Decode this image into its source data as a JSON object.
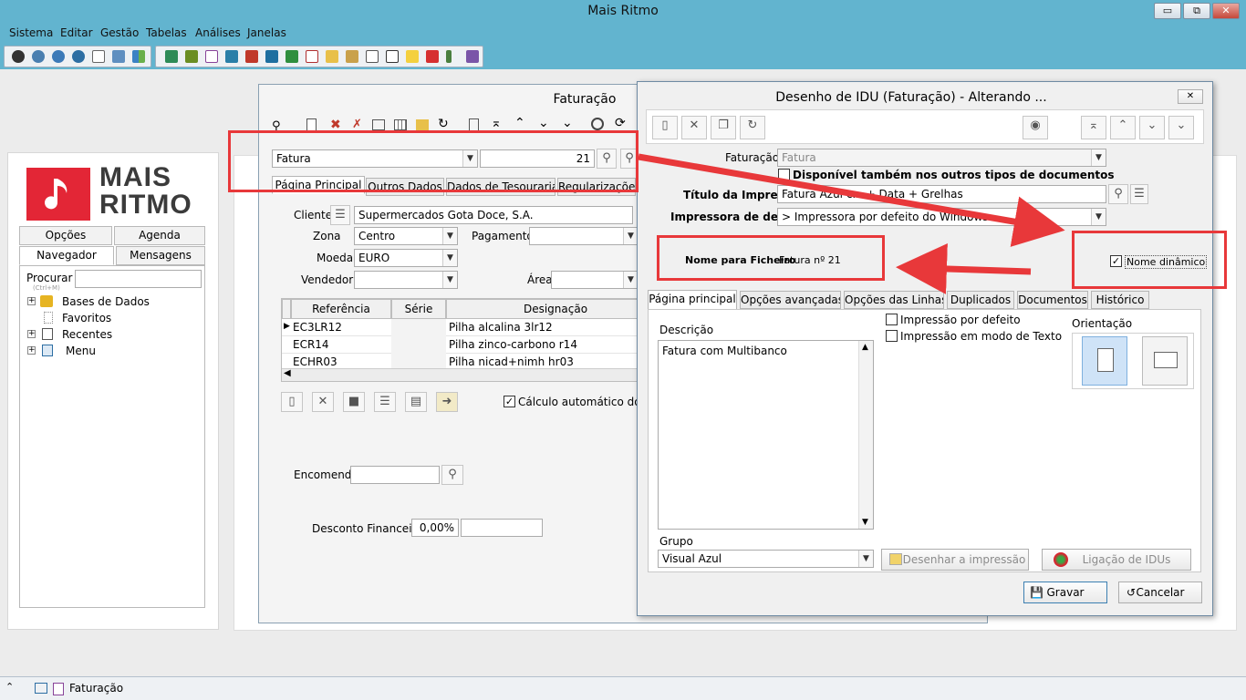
{
  "app": {
    "title": "Mais Ritmo",
    "menu": [
      "Sistema",
      "Editar",
      "Gestão",
      "Tabelas",
      "Análises",
      "Janelas"
    ],
    "window_buttons": {
      "minimize": "▭",
      "restore": "⧉",
      "close": "✕"
    }
  },
  "left_panel": {
    "logo": {
      "line1": "MAIS",
      "line2": "RITMO"
    },
    "tabs": [
      "Opções",
      "Agenda",
      "Navegador",
      "Mensagens"
    ],
    "search_label": "Procurar :",
    "search_hint": "(Ctrl+M)",
    "tree": [
      "Bases de Dados",
      "Favoritos",
      "Recentes",
      "Menu"
    ]
  },
  "faturacao": {
    "title": "Faturação",
    "doc_type": "Fatura",
    "doc_number": "21",
    "tabs": [
      "Página Principal",
      "Outros Dados",
      "Dados de Tesouraria",
      "Regularizações"
    ],
    "labels": {
      "cliente": "Cliente",
      "zona": "Zona",
      "pagamento": "Pagamento",
      "moeda": "Moeda",
      "vendedor": "Vendedor",
      "area": "Área",
      "encomenda": "Encomenda",
      "desconto": "Desconto Financeiro",
      "calculo": "Cálculo automático dos to"
    },
    "values": {
      "cliente": "Supermercados Gota Doce, S.A.",
      "zona": "Centro",
      "moeda": "EURO",
      "desconto": "0,00%"
    },
    "grid": {
      "headers": [
        "Referência",
        "Série",
        "Designação"
      ],
      "rows": [
        {
          "ref": "EC3LR12",
          "serie": "",
          "designacao": "Pilha alcalina 3lr12"
        },
        {
          "ref": "ECR14",
          "serie": "",
          "designacao": "Pilha zinco-carbono r14"
        },
        {
          "ref": "ECHR03",
          "serie": "",
          "designacao": "Pilha nicad+nimh hr03"
        }
      ]
    }
  },
  "idu": {
    "title": "Desenho de IDU (Faturação) - Alterando ...",
    "labels": {
      "faturacao": "Faturação",
      "disponivel": "Disponível também nos outros tipos de documentos",
      "titulo": "Título da Impressão",
      "impressora": "Impressora de destino",
      "nome_ficheiro": "Nome para Ficheiro",
      "nome_dinamico": "Nome dinâmico",
      "descricao": "Descrição",
      "impressao_defeito": "Impressão por defeito",
      "impressao_texto": "Impressão em modo de Texto",
      "orientacao": "Orientação",
      "grupo": "Grupo"
    },
    "values": {
      "faturacao": "Fatura",
      "titulo": "Fatura Azul c... + Data + Grelhas",
      "impressora": "> Impressora por defeito do Windows",
      "nome_ficheiro": "Fatura nº 21",
      "descricao": "Fatura com Multibanco",
      "grupo": "Visual Azul"
    },
    "tabs": [
      "Página principal",
      "Opções avançadas",
      "Opções das Linhas",
      "Duplicados",
      "Documentos",
      "Histórico"
    ],
    "buttons": {
      "desenhar": "Desenhar a impressão",
      "ligacao": "Ligação de IDUs",
      "gravar": "Gravar",
      "cancelar": "Cancelar"
    },
    "checked": {
      "disponivel": false,
      "nome_dinamico": true,
      "impressao_defeito": false,
      "impressao_texto": false
    }
  },
  "statusbar": {
    "item": "Faturação"
  },
  "colors": {
    "titlebar": "#62b4cf",
    "accent_red": "#e8383a",
    "logo_red": "#e32636"
  }
}
